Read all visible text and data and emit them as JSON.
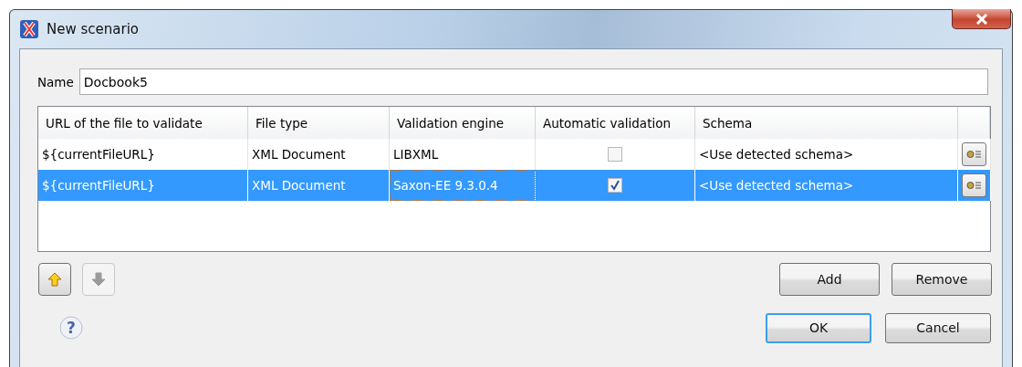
{
  "window": {
    "title": "New scenario"
  },
  "name_field": {
    "label": "Name",
    "value": "Docbook5"
  },
  "table": {
    "columns": [
      "URL of the file to validate",
      "File type",
      "Validation engine",
      "Automatic validation",
      "Schema"
    ],
    "rows": [
      {
        "url": "${currentFileURL}",
        "file_type": "XML Document",
        "engine": "LIBXML",
        "automatic_validation": false,
        "schema": "<Use detected schema>",
        "selected": false
      },
      {
        "url": "${currentFileURL}",
        "file_type": "XML Document",
        "engine": "Saxon-EE 9.3.0.4",
        "automatic_validation": true,
        "schema": "<Use detected schema>",
        "selected": true
      }
    ]
  },
  "move_buttons": [
    {
      "kind": "up",
      "disabled": false
    },
    {
      "kind": "down",
      "disabled": true
    }
  ],
  "table_buttons": [
    "Add",
    "Remove"
  ],
  "help_button": {
    "label": "?"
  },
  "dialog_buttons": [
    {
      "label": "OK",
      "default": true
    },
    {
      "label": "Cancel",
      "default": false
    }
  ]
}
